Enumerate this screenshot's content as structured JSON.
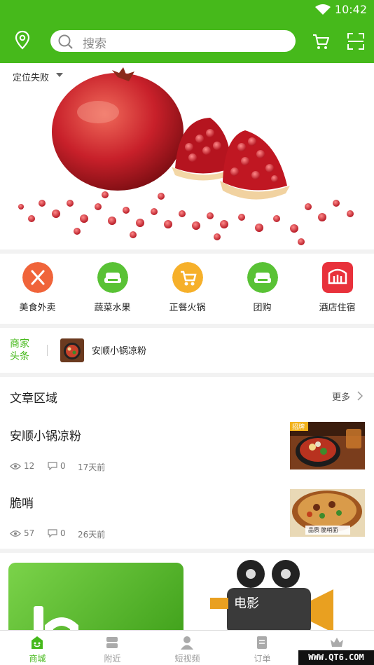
{
  "status_bar": {
    "time": "10:42"
  },
  "header": {
    "search_placeholder": "搜索"
  },
  "location": {
    "label": "定位失败"
  },
  "categories": [
    {
      "label": "美食外卖",
      "icon": "utensils-icon",
      "color": "#f0643a"
    },
    {
      "label": "蔬菜水果",
      "icon": "sofa-icon",
      "color": "#59c235"
    },
    {
      "label": "正餐火锅",
      "icon": "stroller-icon",
      "color": "#f6b02a"
    },
    {
      "label": "团购",
      "icon": "sofa-icon",
      "color": "#59c235"
    },
    {
      "label": "酒店住宿",
      "icon": "hotel-icon",
      "color": "#e8313b"
    }
  ],
  "ticker": {
    "tag": "商家头条",
    "text": "安顺小锅凉粉"
  },
  "articles_section": {
    "title": "文章区域",
    "more": "更多",
    "items": [
      {
        "title": "安顺小锅凉粉",
        "views": "12",
        "comments": "0",
        "time": "17天前",
        "badge": "招牌"
      },
      {
        "title": "脆哨",
        "views": "57",
        "comments": "0",
        "time": "26天前",
        "caption": "品质 脆哨面"
      }
    ]
  },
  "promo": {
    "movie_label": "电影"
  },
  "tabs": [
    {
      "label": "商城",
      "icon": "shop-icon",
      "active": true
    },
    {
      "label": "附近",
      "icon": "nearby-icon",
      "active": false
    },
    {
      "label": "短视频",
      "icon": "video-icon",
      "active": false
    },
    {
      "label": "订单",
      "icon": "order-icon",
      "active": false
    },
    {
      "label": "",
      "icon": "crown-icon",
      "active": false
    }
  ],
  "watermark": "WWW.QT6.COM",
  "colors": {
    "brand": "#46b91b"
  }
}
